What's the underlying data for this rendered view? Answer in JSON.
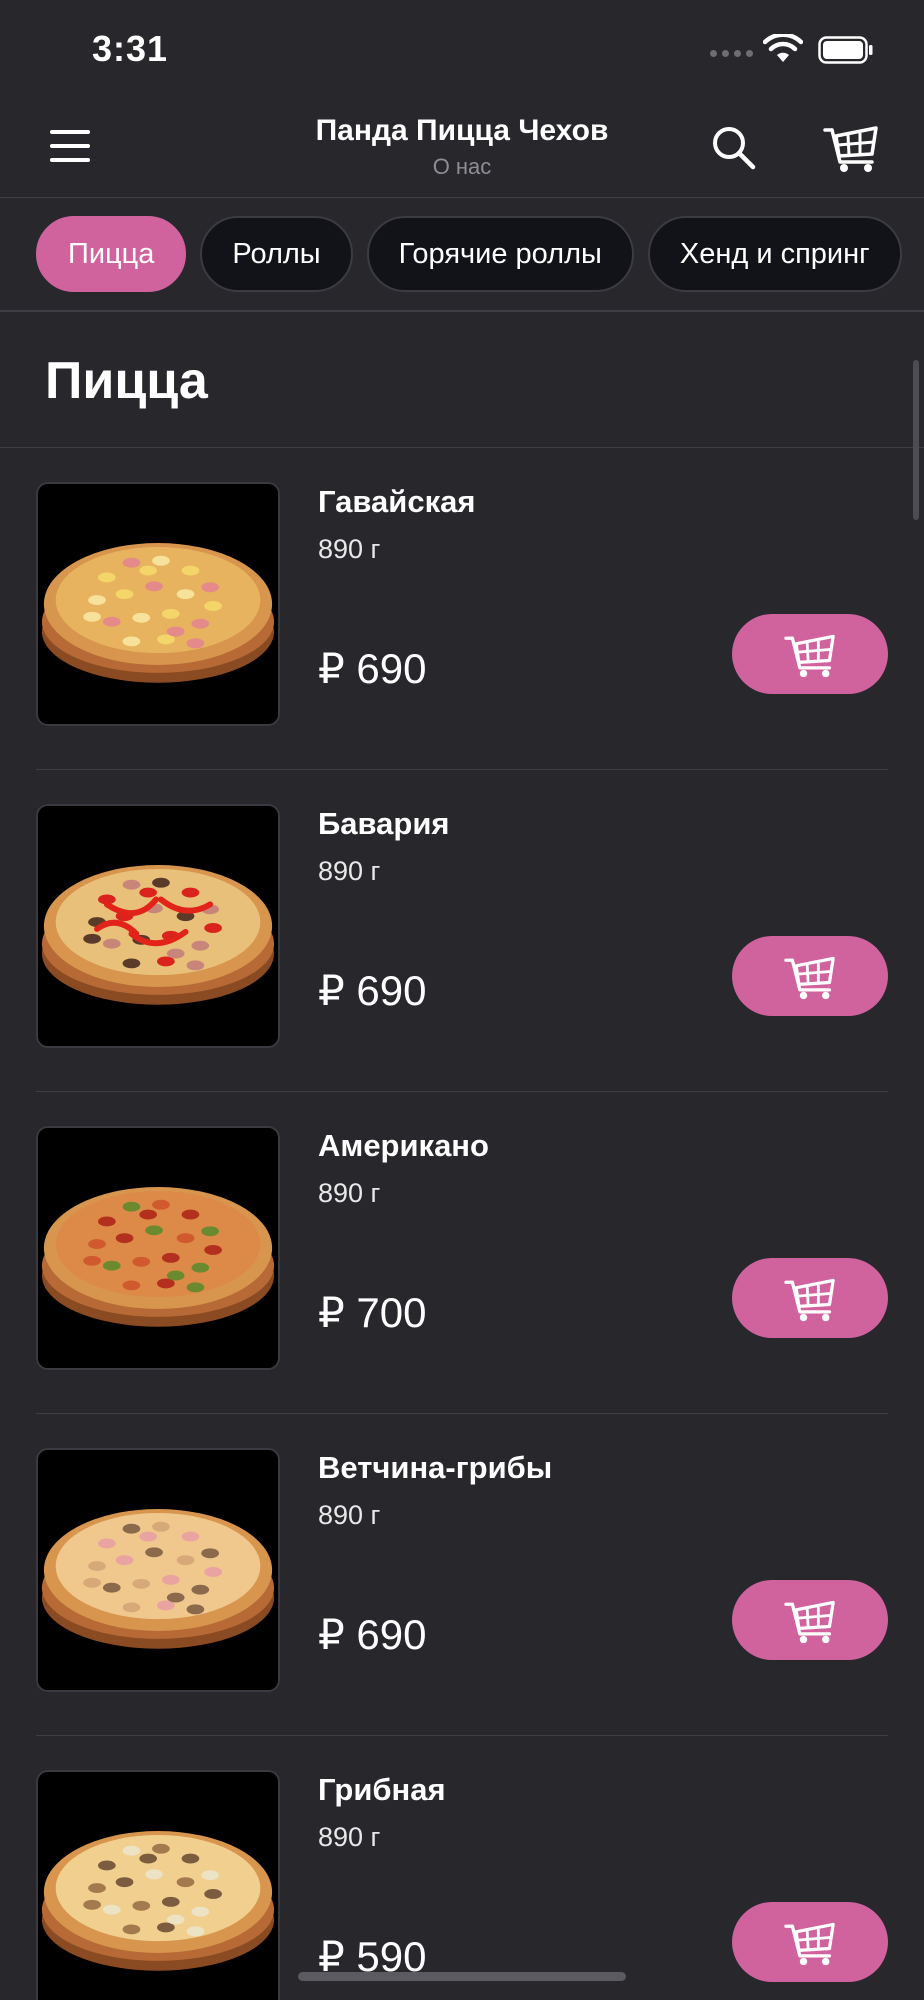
{
  "status_bar": {
    "time": "3:31",
    "icons": [
      "signal-icon",
      "wifi-icon",
      "battery-icon"
    ]
  },
  "header": {
    "title": "Панда Пицца Чехов",
    "subtitle": "О нас",
    "icons": [
      "menu-icon",
      "search-icon",
      "cart-icon"
    ]
  },
  "categories": [
    {
      "label": "Пицца",
      "active": true
    },
    {
      "label": "Роллы",
      "active": false
    },
    {
      "label": "Горячие роллы",
      "active": false
    },
    {
      "label": "Хенд и спринг",
      "active": false
    }
  ],
  "section": {
    "title": "Пицца"
  },
  "products": [
    {
      "name": "Гавайская",
      "weight": "890 г",
      "price": "₽ 690",
      "topping": "hawaiian"
    },
    {
      "name": "Бавария",
      "weight": "890 г",
      "price": "₽ 690",
      "topping": "peppers"
    },
    {
      "name": "Американо",
      "weight": "890 г",
      "price": "₽ 700",
      "topping": "pepperoni"
    },
    {
      "name": "Ветчина-грибы",
      "weight": "890 г",
      "price": "₽ 690",
      "topping": "ham-mushroom"
    },
    {
      "name": "Грибная",
      "weight": "890 г",
      "price": "₽ 590",
      "topping": "mushroom"
    }
  ],
  "colors": {
    "background": "#27272c",
    "accent": "#d0639e",
    "tab_inactive": "#121318",
    "divider": "#3e3e44",
    "subtitle": "#8d8d93"
  }
}
